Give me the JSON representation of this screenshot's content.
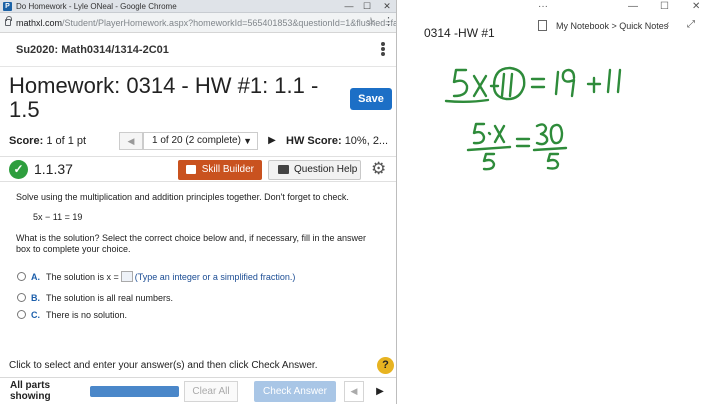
{
  "browser": {
    "window_title": "Do Homework - Lyle ONeal - Google Chrome",
    "url_host": "mathxl.com",
    "url_path": "/Student/PlayerHomework.aspx?homeworkId=565401853&questionId=1&flushed=fals...",
    "controls": {
      "minimize": "—",
      "maximize": "☐",
      "close": "✕"
    }
  },
  "course": {
    "name": "Su2020: Math0314/1314-2C01"
  },
  "homework": {
    "title": "Homework: 0314 - HW #1: 1.1 - 1.5",
    "save_label": "Save"
  },
  "score": {
    "label": "Score:",
    "value": "1 of 1 pt",
    "question_select": "1 of 20 (2 complete)",
    "hw_score_label": "HW Score:",
    "hw_score_value": "10%, 2..."
  },
  "question": {
    "number": "1.1.37",
    "skill_builder_label": "Skill Builder",
    "question_help_label": "Question Help",
    "instructions": "Solve using the multiplication and addition principles together. Don't forget to check.",
    "equation": "5x − 11 = 19",
    "prompt": "What is the solution? Select the correct choice below and, if necessary, fill in the answer box to complete your choice.",
    "choices": [
      {
        "letter": "A.",
        "text": "The solution is x =",
        "hint": "(Type an integer or a simplified fraction.)"
      },
      {
        "letter": "B.",
        "text": "The solution is all real numbers."
      },
      {
        "letter": "C.",
        "text": "There is no solution."
      }
    ]
  },
  "footer": {
    "instruction": "Click to select and enter your answer(s) and then click Check Answer.",
    "help_glyph": "?",
    "all_parts_label": "All parts showing",
    "progress": 1.0,
    "clear_all_label": "Clear All",
    "check_answer_label": "Check Answer"
  },
  "onenote": {
    "page_title": "0314 -HW #1",
    "breadcrumb": "My Notebook > Quick Notes",
    "controls": {
      "more": "···",
      "minimize": "—",
      "maximize": "☐",
      "close": "✕"
    }
  },
  "ink_color": "#2e8b3a"
}
